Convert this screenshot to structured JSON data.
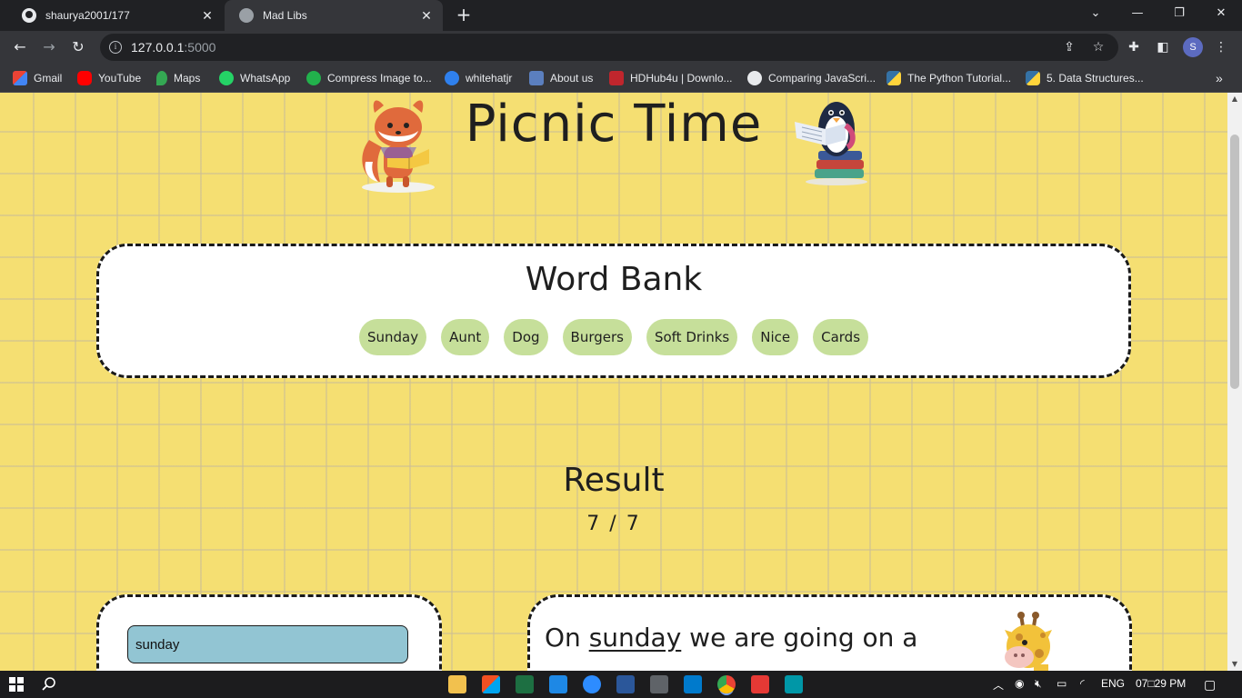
{
  "browser": {
    "tabs": [
      {
        "title": "shaurya2001/177",
        "active": false
      },
      {
        "title": "Mad Libs",
        "active": true
      }
    ],
    "new_tab": "+",
    "url_host": "127.0.0.1",
    "url_port": ":5000",
    "profile_initial": "S",
    "bookmarks": [
      "Gmail",
      "YouTube",
      "Maps",
      "WhatsApp",
      "Compress Image to...",
      "whitehatjr",
      "About us",
      "HDHub4u | Downlo...",
      "Comparing JavaScri...",
      "The Python Tutorial...",
      "5. Data Structures..."
    ],
    "bookmarks_overflow": "»"
  },
  "page": {
    "title": "Picnic Time",
    "word_bank": {
      "heading": "Word Bank",
      "words": [
        "Sunday",
        "Aunt",
        "Dog",
        "Burgers",
        "Soft Drinks",
        "Nice",
        "Cards"
      ]
    },
    "result": {
      "heading": "Result",
      "score": "7 / 7"
    },
    "inputs": [
      {
        "value": "sunday"
      }
    ],
    "story": {
      "before": "On ",
      "blank": "sunday",
      "after": " we are going on a"
    }
  },
  "taskbar": {
    "language": "ENG",
    "time": "07□29 PM"
  },
  "colors": {
    "page_background": "#f5df72",
    "chip": "#c6df9a",
    "input": "#92c5d3"
  }
}
